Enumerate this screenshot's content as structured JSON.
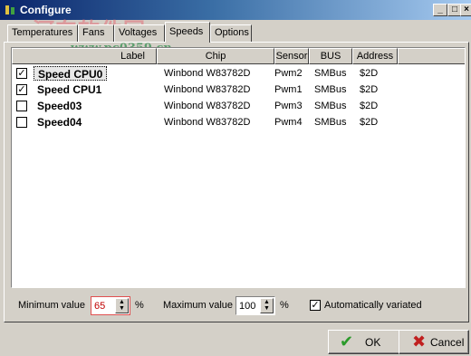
{
  "window": {
    "title": "Configure",
    "min_glyph": "_",
    "max_glyph": "□",
    "close_glyph": "×"
  },
  "watermark": {
    "text": "河东软件园",
    "url": "www.pc0359.cn"
  },
  "tabs": [
    {
      "label": "Temperatures"
    },
    {
      "label": "Fans"
    },
    {
      "label": "Voltages"
    },
    {
      "label": "Speeds",
      "active": true
    },
    {
      "label": "Options"
    }
  ],
  "list": {
    "columns": [
      "Label",
      "Chip",
      "Sensor",
      "BUS",
      "Address"
    ],
    "rows": [
      {
        "checked": "✓",
        "label": "Speed CPU0",
        "chip": "Winbond W83782D",
        "sensor": "Pwm2",
        "bus": "SMBus",
        "address": "$2D"
      },
      {
        "checked": "✓",
        "label": "Speed CPU1",
        "chip": "Winbond W83782D",
        "sensor": "Pwm1",
        "bus": "SMBus",
        "address": "$2D"
      },
      {
        "checked": "",
        "label": "Speed03",
        "chip": "Winbond W83782D",
        "sensor": "Pwm3",
        "bus": "SMBus",
        "address": "$2D"
      },
      {
        "checked": "",
        "label": "Speed04",
        "chip": "Winbond W83782D",
        "sensor": "Pwm4",
        "bus": "SMBus",
        "address": "$2D"
      }
    ]
  },
  "controls": {
    "min_label": "Minimum value",
    "min_value": "65",
    "min_unit": "%",
    "max_label": "Maximum value",
    "max_value": "100",
    "max_unit": "%",
    "auto_checked": "✓",
    "auto_label": "Automatically variated"
  },
  "buttons": {
    "ok": "OK",
    "cancel": "Cancel"
  },
  "colors": {
    "titlebar_start": "#0a246a",
    "face": "#d4d0c8",
    "ok_icon": "#2a9a2a",
    "cancel_icon": "#c02020"
  }
}
